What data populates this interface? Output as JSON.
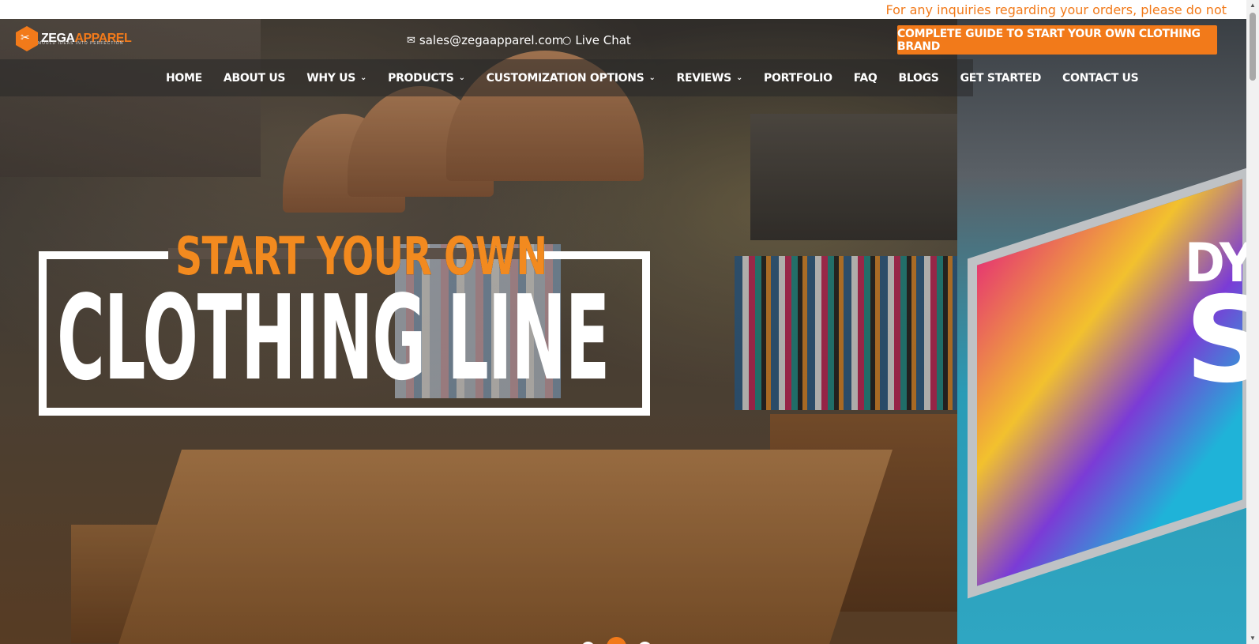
{
  "ticker": {
    "text": "For any inquiries regarding your orders, please do not"
  },
  "header": {
    "logo_main": "ZEGA",
    "logo_accent": "APPAREL",
    "logo_tagline": "MOULD IDEAS INTO PERFECTION",
    "email": "sales@zegaapparel.com",
    "chat": "Live Chat",
    "cta": "COMPLETE GUIDE TO START YOUR OWN CLOTHING BRAND"
  },
  "nav": {
    "items": [
      {
        "label": "HOME",
        "dropdown": false
      },
      {
        "label": "ABOUT US",
        "dropdown": false
      },
      {
        "label": "WHY US",
        "dropdown": true
      },
      {
        "label": "PRODUCTS",
        "dropdown": true
      },
      {
        "label": "CUSTOMIZATION OPTIONS",
        "dropdown": true
      },
      {
        "label": "REVIEWS",
        "dropdown": true
      },
      {
        "label": "PORTFOLIO",
        "dropdown": false
      },
      {
        "label": "FAQ",
        "dropdown": false
      },
      {
        "label": "BLOGS",
        "dropdown": false
      },
      {
        "label": "GET STARTED",
        "dropdown": false
      },
      {
        "label": "CONTACT US",
        "dropdown": false
      }
    ]
  },
  "hero": {
    "line1": "START YOUR OWN",
    "line2": "CLOTHING LINE",
    "next_line1": "DY",
    "next_line2": "S"
  },
  "slider": {
    "count": 3,
    "active": 2
  },
  "icons": {
    "email": "mail-icon",
    "chat": "chat-icon",
    "chevron": "chevron-down-icon"
  },
  "colors": {
    "accent": "#f27a1a"
  }
}
